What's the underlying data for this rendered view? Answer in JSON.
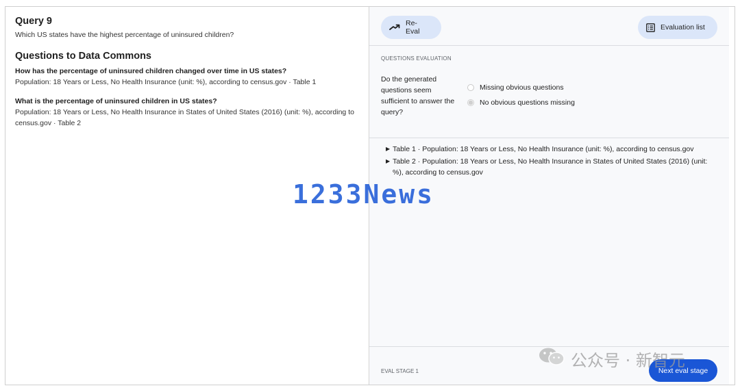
{
  "query": {
    "title": "Query 9",
    "text": "Which US states have the highest percentage of uninsured children?"
  },
  "data_commons": {
    "heading": "Questions to Data Commons",
    "items": [
      {
        "question": "How has the percentage of uninsured children changed over time in US states?",
        "source": "Population: 18 Years or Less, No Health Insurance (unit: %), according to census.gov · Table 1"
      },
      {
        "question": "What is the percentage of uninsured children in US states?",
        "source": "Population: 18 Years or Less, No Health Insurance in States of United States (2016) (unit: %), according to census.gov · Table 2"
      }
    ]
  },
  "toolbar": {
    "reeval_label": "Re-Eval",
    "reeval_icon": "trending-arrow-icon",
    "evallist_label": "Evaluation list",
    "evallist_icon": "list-icon",
    "pill_color": "#dbe6f9"
  },
  "evaluation": {
    "section_label": "QUESTIONS EVALUATION",
    "question": "Do the generated questions seem sufficient to answer the query?",
    "options": [
      {
        "label": "Missing obvious questions",
        "selected": false
      },
      {
        "label": "No obvious questions missing",
        "selected": true
      }
    ]
  },
  "tables": [
    {
      "label": "Table 1 · Population: 18 Years or Less, No Health Insurance (unit: %), according to census.gov"
    },
    {
      "label": "Table 2 · Population: 18 Years or Less, No Health Insurance in States of United States (2016) (unit: %), according to census.gov"
    }
  ],
  "footer": {
    "stage_label": "EVAL STAGE 1",
    "next_label": "Next eval stage",
    "accent_color": "#1a56d6"
  },
  "watermarks": {
    "center": "1233News",
    "bottom_right": "公众号 · 新智元",
    "bottom_right_icon": "wechat-icon"
  }
}
